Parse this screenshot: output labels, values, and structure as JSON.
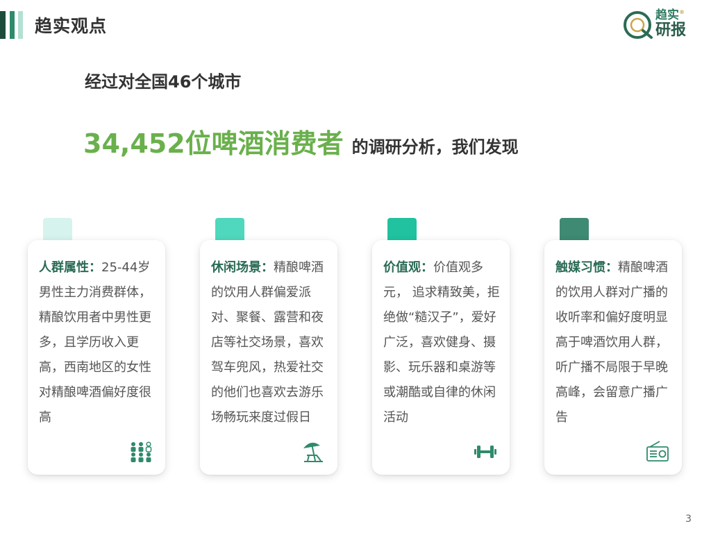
{
  "header": {
    "title": "趋实观点"
  },
  "logo": {
    "line1": "趋实",
    "line2": "研报",
    "reg": "®"
  },
  "headline": {
    "line1": "经过对全国46个城市",
    "highlight": "34,452位啤酒消费者",
    "rest": "的调研分析，我们发现"
  },
  "colors": {
    "tab1": "#d6f3ee",
    "tab2": "#4fd8bd",
    "tab3": "#20c29f",
    "tab4": "#3e8a72",
    "accent_green": "#6ab04c",
    "label": "#2a6b55"
  },
  "cards": [
    {
      "label": "人群属性：",
      "text": "25-44岁男性主力消费群体，精酿饮用者中男性更多，且学历收入更高，西南地区的女性对精酿啤酒偏好度很高",
      "icon": "people-group-icon"
    },
    {
      "label": "休闲场景：",
      "text": "精酿啤酒的饮用人群偏爱派对、聚餐、露营和夜店等社交场景，喜欢驾车兜风，热爱社交的他们也喜欢去游乐场畅玩来度过假日",
      "icon": "beach-umbrella-icon"
    },
    {
      "label": "价值观：",
      "text": "价值观多元， 追求精致美，拒绝做“糙汉子”，爱好广泛，喜欢健身、摄影、玩乐器和桌游等或潮酷或自律的休闲活动",
      "icon": "dumbbell-icon"
    },
    {
      "label": "触媒习惯：",
      "text": "精酿啤酒的饮用人群对广播的收听率和偏好度明显高于啤酒饮用人群，听广播不局限于早晚高峰，会留意广播广告",
      "icon": "radio-icon"
    }
  ],
  "page_number": "3"
}
